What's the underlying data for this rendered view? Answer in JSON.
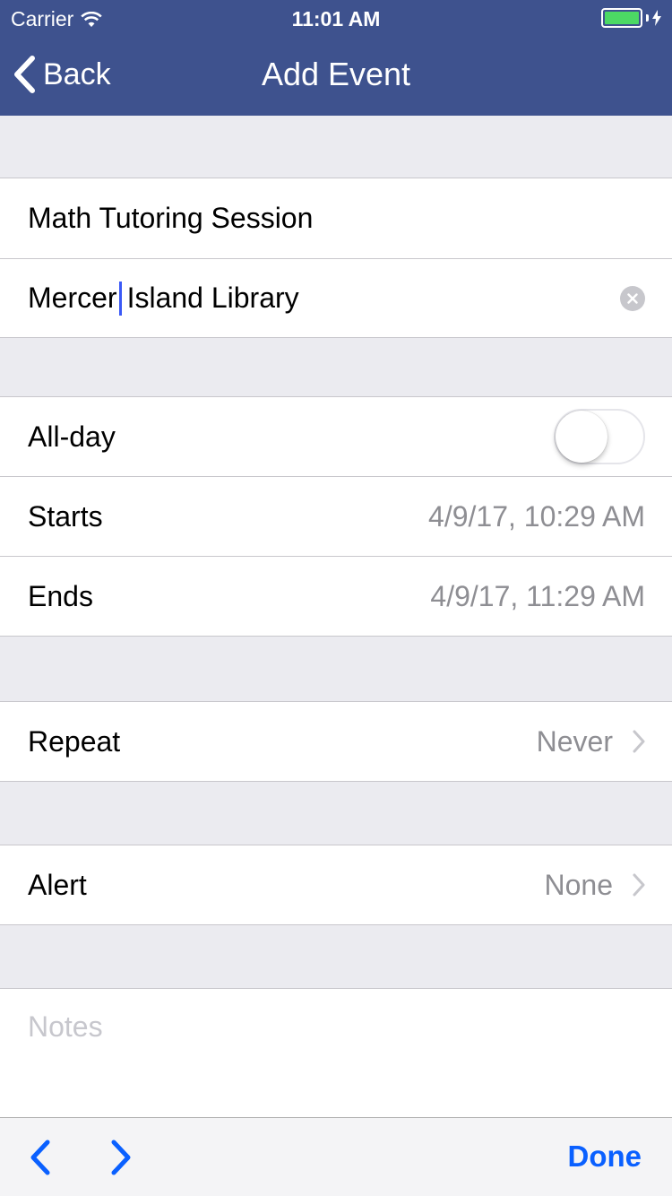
{
  "status_bar": {
    "carrier": "Carrier",
    "time": "11:01 AM",
    "battery_color": "#4cd964"
  },
  "nav": {
    "back_label": "Back",
    "title": "Add Event",
    "bar_color": "#3e528e"
  },
  "event": {
    "title_value": "Math Tutoring Session",
    "location_before_cursor": "Mercer",
    "location_after_cursor": "Island Library"
  },
  "timing": {
    "all_day_label": "All-day",
    "all_day_on": false,
    "starts_label": "Starts",
    "starts_value": "4/9/17, 10:29 AM",
    "ends_label": "Ends",
    "ends_value": "4/9/17, 11:29 AM"
  },
  "repeat": {
    "label": "Repeat",
    "value": "Never"
  },
  "alert": {
    "label": "Alert",
    "value": "None"
  },
  "notes": {
    "placeholder": "Notes"
  },
  "toolbar": {
    "done_label": "Done",
    "accent": "#0a60ff"
  },
  "icons": [
    "wifi-icon",
    "battery-icon",
    "charging-icon",
    "chevron-left-icon",
    "clear-icon",
    "chevron-right-icon"
  ]
}
